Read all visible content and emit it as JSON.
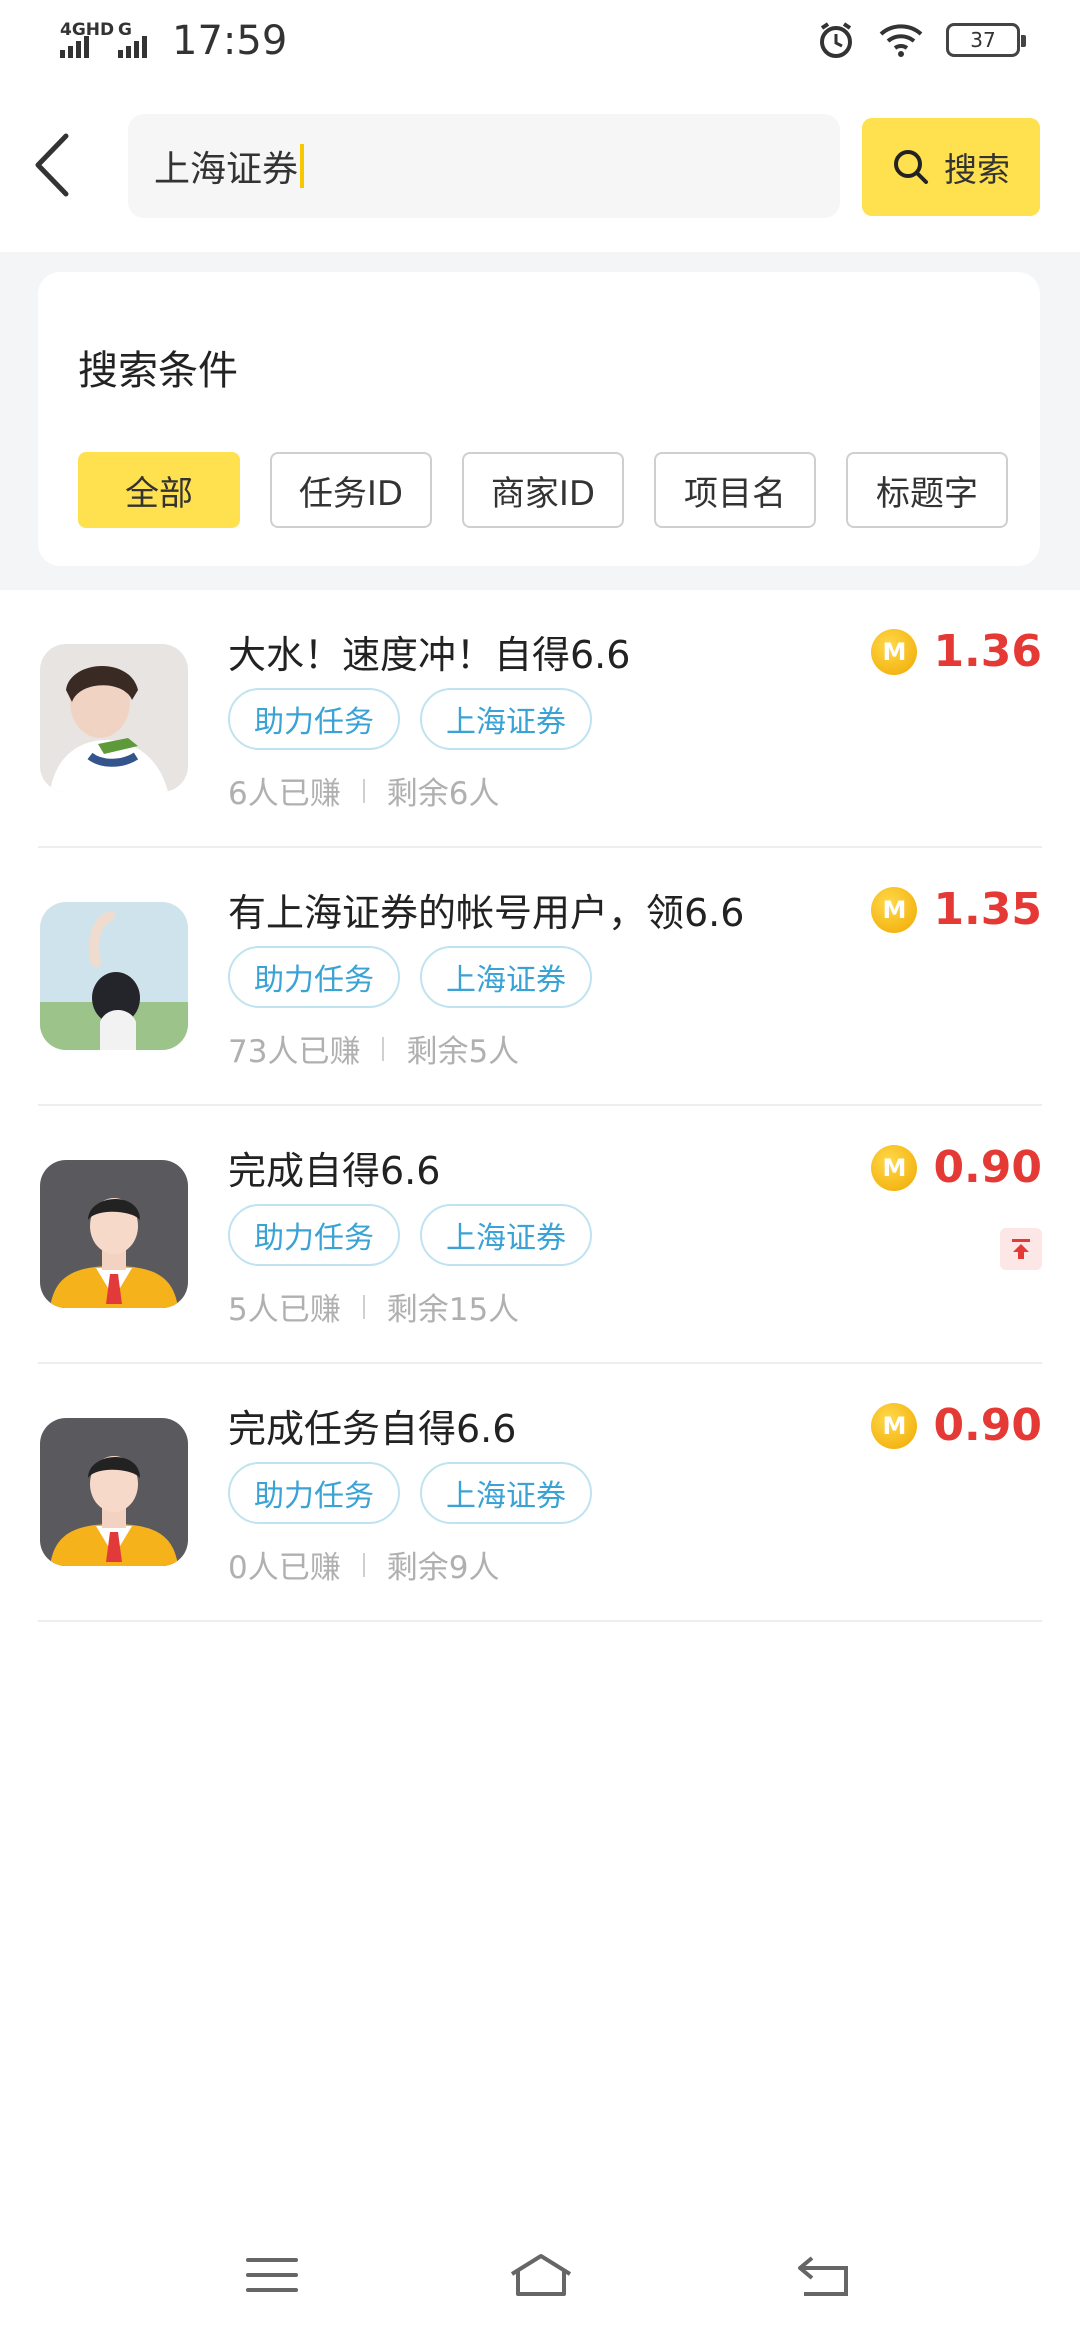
{
  "status_bar": {
    "network1": "4GHD",
    "network2": "G",
    "time": "17:59",
    "battery": "37"
  },
  "search": {
    "query": "上海证券",
    "button_label": "搜索"
  },
  "filter": {
    "title": "搜索条件",
    "chips": [
      {
        "label": "全部",
        "active": true
      },
      {
        "label": "任务ID",
        "active": false
      },
      {
        "label": "商家ID",
        "active": false
      },
      {
        "label": "项目名",
        "active": false
      },
      {
        "label": "标题字",
        "active": false
      }
    ]
  },
  "tasks": [
    {
      "title": "大水！速度冲！自得6.6",
      "tags": [
        "助力任务",
        "上海证券"
      ],
      "earned": "6人已赚",
      "remaining": "剩余6人",
      "reward": "1.36",
      "coin": "M"
    },
    {
      "title": "有上海证券的帐号用户，领6.6",
      "tags": [
        "助力任务",
        "上海证券"
      ],
      "earned": "73人已赚",
      "remaining": "剩余5人",
      "reward": "1.35",
      "coin": "M"
    },
    {
      "title": "完成自得6.6",
      "tags": [
        "助力任务",
        "上海证券"
      ],
      "earned": "5人已赚",
      "remaining": "剩余15人",
      "reward": "0.90",
      "coin": "M",
      "pinned": true
    },
    {
      "title": "完成任务自得6.6",
      "tags": [
        "助力任务",
        "上海证券"
      ],
      "earned": "0人已赚",
      "remaining": "剩余9人",
      "reward": "0.90",
      "coin": "M"
    }
  ],
  "colors": {
    "accent": "#ffe04f",
    "price": "#e53935",
    "tag_text": "#3aa2d4"
  }
}
